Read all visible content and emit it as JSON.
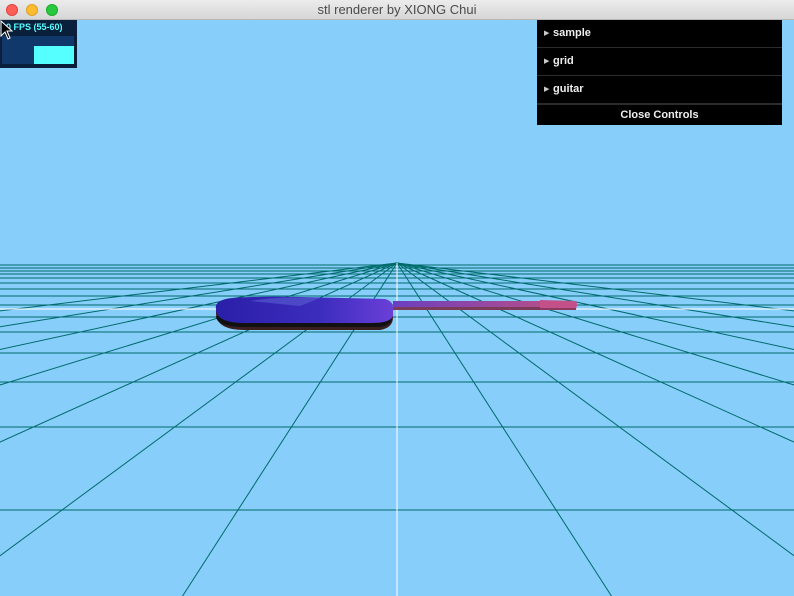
{
  "window": {
    "title": "stl renderer by XIONG Chui"
  },
  "stats": {
    "fps_text": "60 FPS (55-60)",
    "fps": 60,
    "fps_min": 55,
    "fps_max": 60
  },
  "gui": {
    "folders": [
      {
        "label": "sample"
      },
      {
        "label": "grid"
      },
      {
        "label": "guitar"
      }
    ],
    "close_label": "Close Controls"
  },
  "scene": {
    "background_color": "#87cefa",
    "grid_color": "#006b6b",
    "axis_color": "#ffffff",
    "model_colors": [
      "#2a1fa8",
      "#6a3fd8",
      "#b24e8c",
      "#3a1f1f"
    ]
  }
}
